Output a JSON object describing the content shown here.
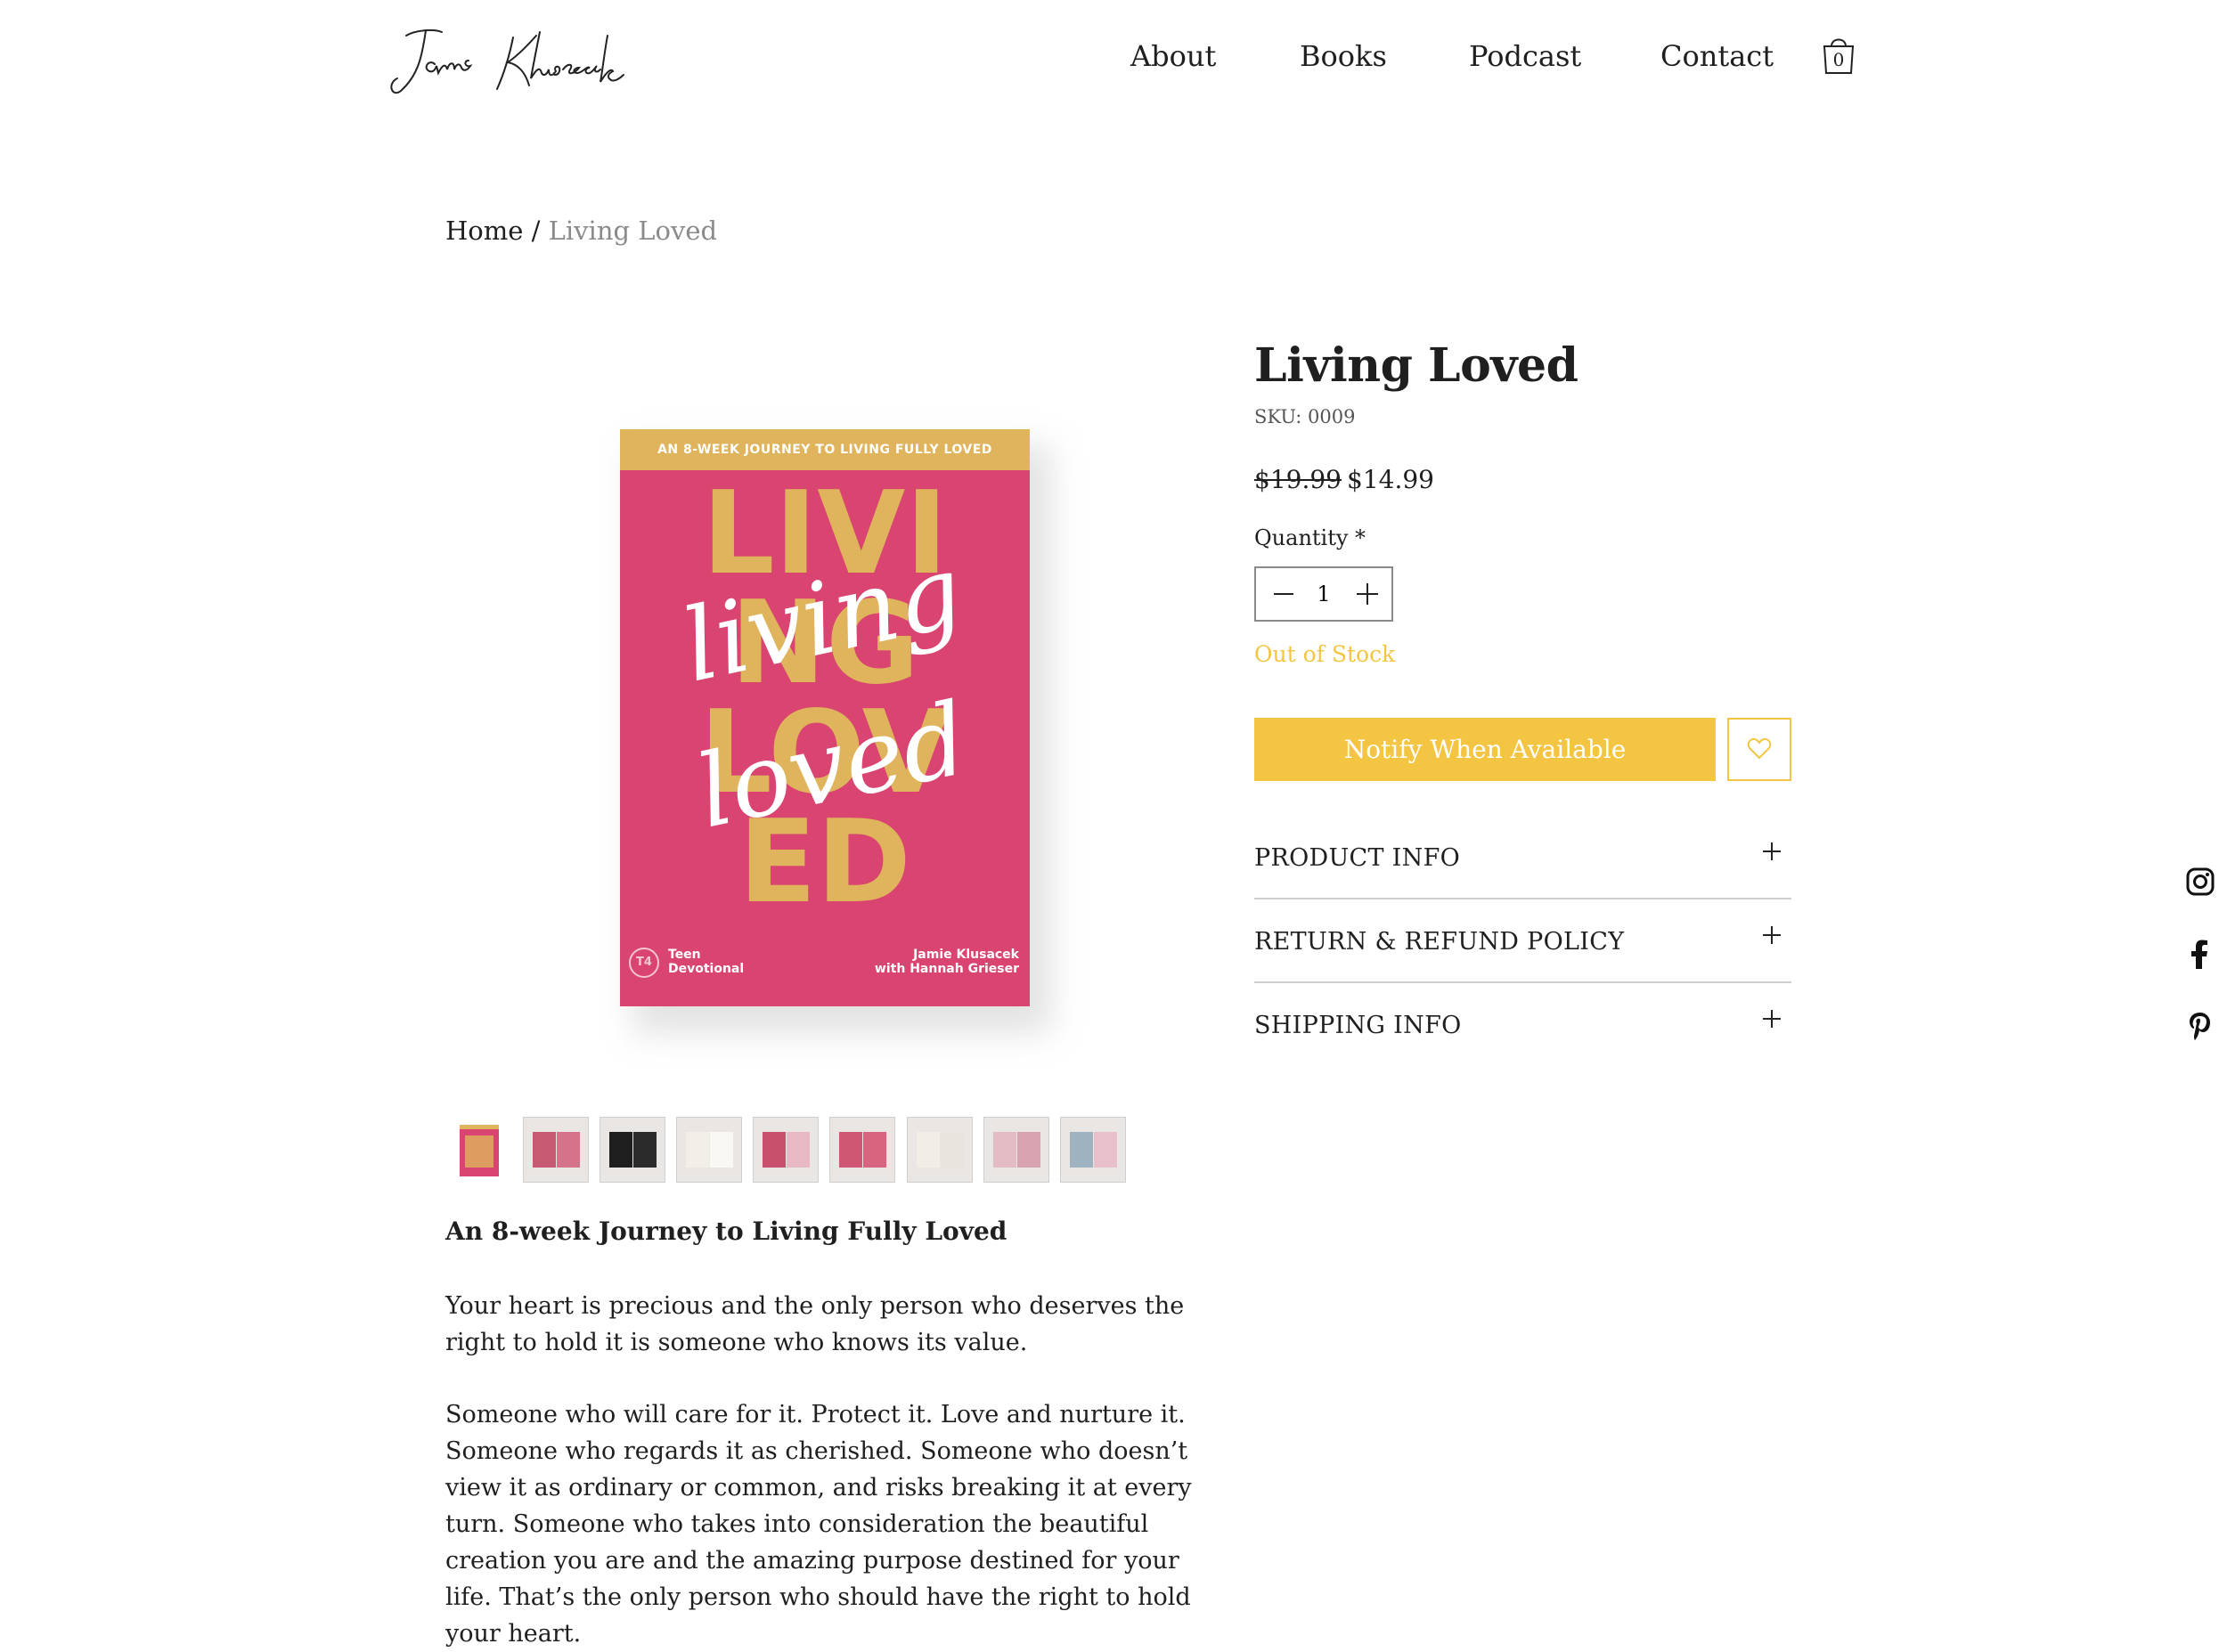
{
  "header": {
    "logo_text": "Jamie Klusacek",
    "nav": [
      "About",
      "Books",
      "Podcast",
      "Contact"
    ],
    "cart_count": "0"
  },
  "breadcrumb": {
    "home": "Home",
    "separator": " / ",
    "current": "Living Loved"
  },
  "product": {
    "title": "Living Loved",
    "sku": "SKU: 0009",
    "old_price": "$19.99",
    "price": "$14.99",
    "quantity_label": "Quantity *",
    "quantity": "1",
    "stock_status": "Out of Stock",
    "notify_label": "Notify When Available",
    "accordions": [
      "PRODUCT INFO",
      "RETURN & REFUND POLICY",
      "SHIPPING INFO"
    ]
  },
  "book_cover": {
    "band": "AN 8-WEEK JOURNEY TO LIVING FULLY LOVED",
    "big_lines": [
      "LIVI",
      "NG",
      "LOV",
      "ED"
    ],
    "script_1": "living",
    "script_2": "loved",
    "badge": "T4",
    "label_line1": "Teen",
    "label_line2": "Devotional",
    "author_line1": "Jamie Klusacek",
    "author_line2": "with Hannah Grieser"
  },
  "description": {
    "heading": "An 8-week Journey to Living Fully Loved",
    "p1": "Your heart is precious and the only person who deserves the right to hold it is someone who knows its value.",
    "p2": "Someone who will care for it. Protect it. Love and nurture it. Someone who regards it as cherished. Someone who doesn’t view it as ordinary or common, and risks breaking it at every turn. Someone who takes into consideration the beautiful creation you are and the amazing purpose destined for your life. That’s the only person who should have the right to hold your heart."
  },
  "colors": {
    "accent": "#f4c542",
    "cover_pink": "#d94470",
    "cover_gold": "#dfb45c",
    "muted": "#8a8a8a"
  },
  "icons": [
    "cart-icon",
    "minus-icon",
    "plus-icon",
    "heart-icon",
    "instagram-icon",
    "facebook-icon",
    "pinterest-icon"
  ],
  "thumbnails_count": 9
}
